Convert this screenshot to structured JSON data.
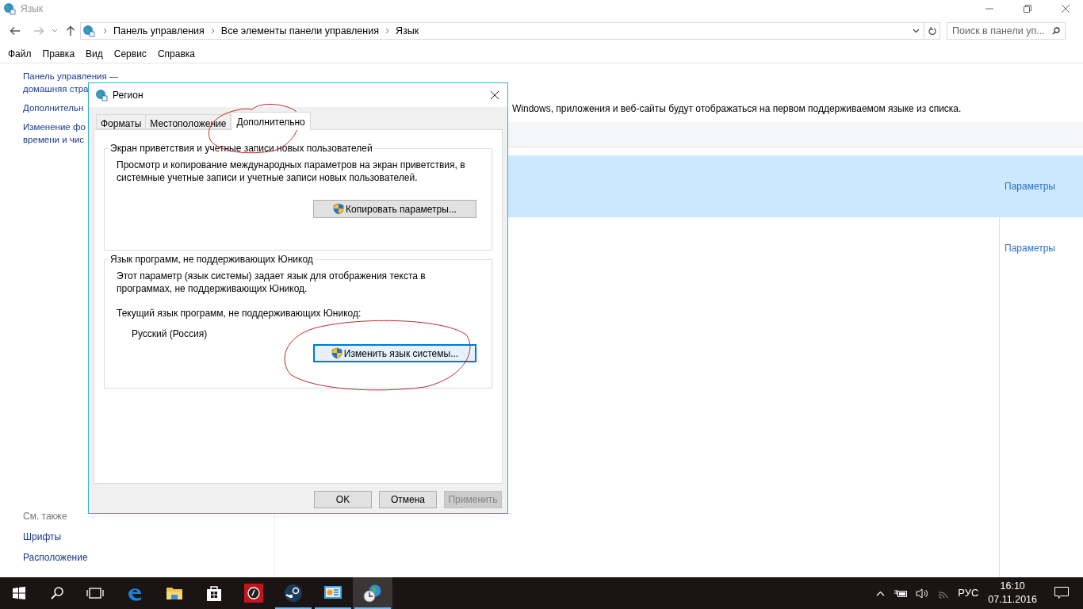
{
  "window": {
    "title": "Язык"
  },
  "address_bar": {
    "path": [
      "Панель управления",
      "Все элементы панели управления",
      "Язык"
    ]
  },
  "search": {
    "placeholder": "Поиск в панели уп..."
  },
  "menu": [
    "Файл",
    "Правка",
    "Вид",
    "Сервис",
    "Справка"
  ],
  "sidebar": {
    "links": [
      {
        "lines": [
          "Панель управления —",
          "домашняя стра"
        ]
      },
      {
        "lines": [
          "Дополнительн"
        ]
      },
      {
        "lines": [
          "Изменение фо",
          "времени и чис"
        ]
      }
    ],
    "see_also": {
      "title": "См. также",
      "links": [
        "Шрифты",
        "Расположение"
      ]
    }
  },
  "main": {
    "description": "Windows, приложения и веб-сайты будут отображаться на первом поддерживаемом языке из списка.",
    "languages": [
      {
        "selected": true,
        "options_link": "Параметры"
      },
      {
        "selected": false,
        "options_link": "Параметры"
      }
    ]
  },
  "dialog": {
    "title": "Регион",
    "tabs": [
      {
        "label": "Форматы",
        "selected": false
      },
      {
        "label": "Местоположение",
        "selected": false
      },
      {
        "label": "Дополнительно",
        "selected": true
      }
    ],
    "groups": [
      {
        "title": "Экран приветствия и учетные записи новых пользователей",
        "text": "Просмотр и копирование международных параметров на экран приветствия, в системные учетные записи и учетные записи новых пользователей.",
        "button": {
          "label": "Копировать параметры...",
          "focused": false
        }
      },
      {
        "title": "Язык программ, не поддерживающих Юникод",
        "text": "Этот параметр (язык системы) задает язык для отображения текста в программах, не поддерживающих Юникод.",
        "current_label": "Текущий язык программ, не поддерживающих Юникод:",
        "current_value": "Русский (Россия)",
        "button": {
          "label": "Изменить язык системы...",
          "focused": true
        }
      }
    ],
    "buttons": [
      {
        "label": "OK",
        "disabled": false
      },
      {
        "label": "Отмена",
        "disabled": false
      },
      {
        "label": "Применить",
        "disabled": true
      }
    ]
  },
  "taskbar": {
    "apps": [
      {
        "kind": "edge",
        "running": false,
        "active": false
      },
      {
        "kind": "explorer",
        "running": false,
        "active": false
      },
      {
        "kind": "store",
        "running": false,
        "active": false
      },
      {
        "kind": "music",
        "running": false,
        "active": false
      },
      {
        "kind": "steam",
        "running": true,
        "active": false
      },
      {
        "kind": "control",
        "running": true,
        "active": false
      },
      {
        "kind": "region",
        "running": true,
        "active": true
      }
    ],
    "language": "РУС",
    "time": "16:10",
    "date": "07.11.2016"
  }
}
